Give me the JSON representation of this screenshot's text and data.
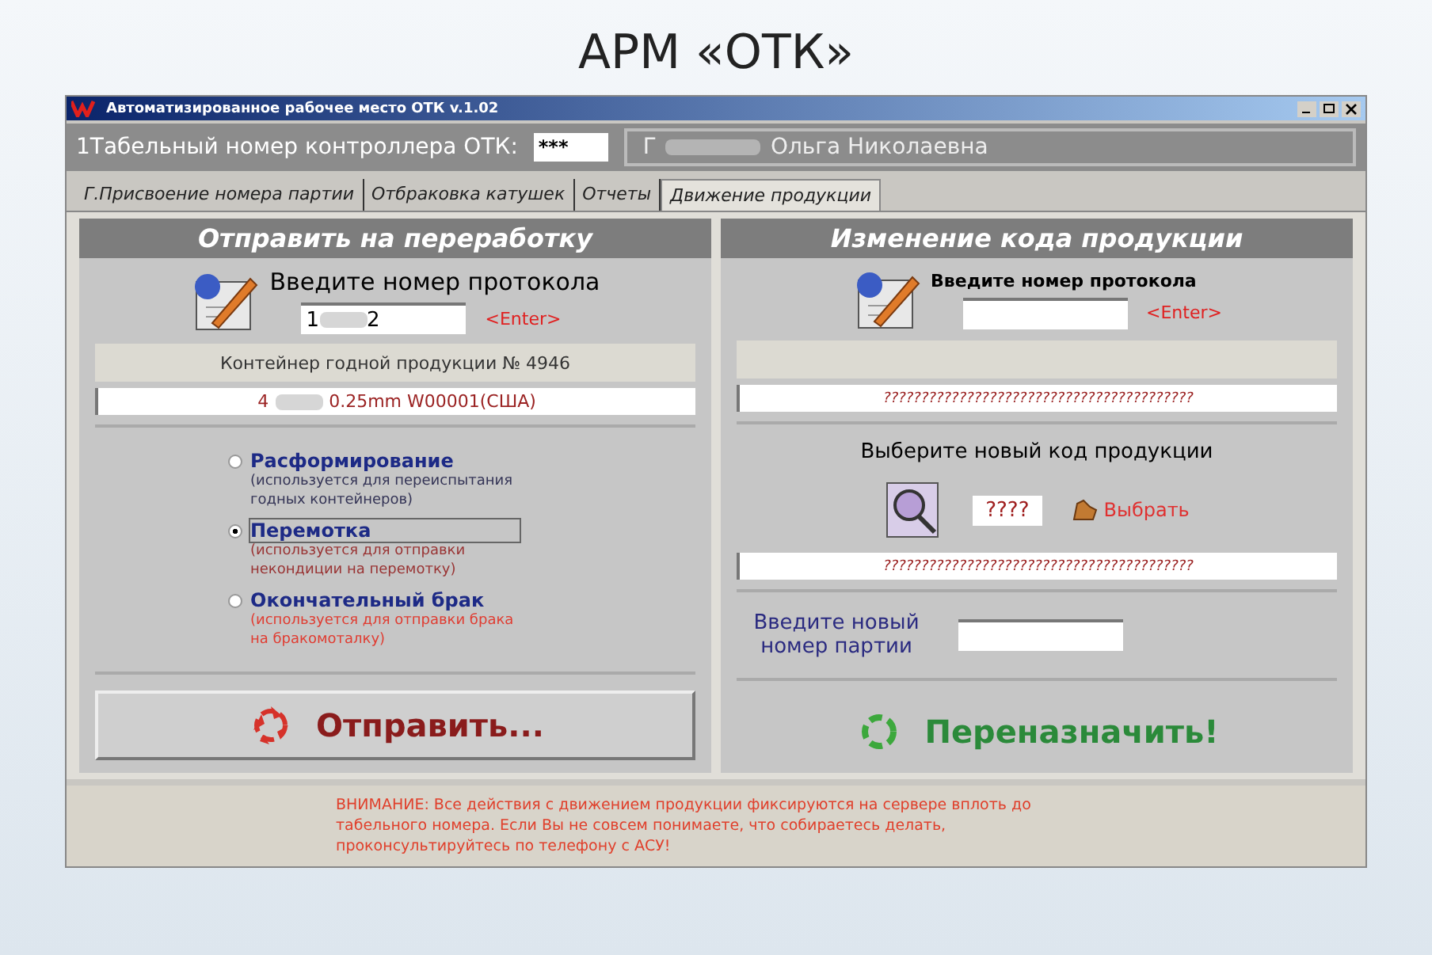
{
  "slide_title": "АРМ «ОТК»",
  "window": {
    "title": "Автоматизированное рабочее место ОТК v.1.02"
  },
  "header": {
    "label": "1Табельный номер контроллера ОТК:",
    "id_value": "***",
    "name_prefix": "Г",
    "name": "Ольга Николаевна"
  },
  "tabs": [
    {
      "label": "Г.Присвоение номера партии",
      "selected": false
    },
    {
      "label": "Отбраковка катушек",
      "selected": false
    },
    {
      "label": "Отчеты",
      "selected": false
    },
    {
      "label": "Движение продукции",
      "selected": true
    }
  ],
  "left": {
    "title": "Отправить на переработку",
    "prompt": "Введите номер протокола",
    "protocol_start": "1",
    "protocol_end": "2",
    "enter": "<Enter>",
    "container": "Контейнер годной продукции № 4946",
    "container_info_start": "4",
    "container_info": "0.25mm  W00001(США)",
    "options": [
      {
        "label": "Расформирование",
        "note": "(используется для переиспытания годных контейнеров)",
        "selected": false,
        "color": "#333355"
      },
      {
        "label": "Перемотка",
        "note": "(используется для отправки некондиции на перемотку)",
        "selected": true,
        "color": "#993333"
      },
      {
        "label": "Окончательный брак",
        "note": "(используется для отправки брака на бракомоталку)",
        "selected": false,
        "color": "#e03c31"
      }
    ],
    "action": "Отправить..."
  },
  "right": {
    "title": "Изменение кода продукции",
    "prompt": "Введите номер протокола",
    "enter": "<Enter>",
    "info": "?????????????????????????????????????????",
    "choose_prompt": "Выберите новый код продукции",
    "code": "????",
    "choose_button": "Выбрать",
    "code_info": "?????????????????????????????????????????",
    "batch_label": "Введите новый номер партии",
    "action": "Переназначить!"
  },
  "warning": "ВНИМАНИЕ: Все действия с движением продукции фиксируются на сервере вплоть до табельного номера. Если Вы не совсем понимаете, что собираетесь делать, проконсультируйтесь по телефону с АСУ!"
}
